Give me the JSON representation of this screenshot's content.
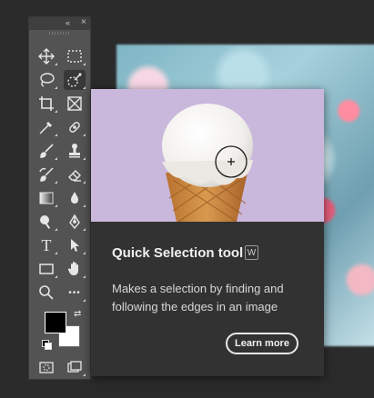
{
  "toolbar": {
    "collapse_glyph": "«",
    "close_glyph": "×",
    "tools": [
      {
        "icon": "move-icon"
      },
      {
        "icon": "rectangular-marquee-icon"
      },
      {
        "icon": "lasso-icon"
      },
      {
        "icon": "quick-selection-icon",
        "active": true
      },
      {
        "icon": "crop-icon"
      },
      {
        "icon": "frame-icon"
      },
      {
        "icon": "eyedropper-icon"
      },
      {
        "icon": "spot-healing-brush-icon"
      },
      {
        "icon": "brush-icon"
      },
      {
        "icon": "clone-stamp-icon"
      },
      {
        "icon": "history-brush-icon"
      },
      {
        "icon": "eraser-icon"
      },
      {
        "icon": "gradient-icon"
      },
      {
        "icon": "blur-icon"
      },
      {
        "icon": "dodge-icon"
      },
      {
        "icon": "pen-icon"
      },
      {
        "icon": "type-icon"
      },
      {
        "icon": "path-selection-icon"
      },
      {
        "icon": "rectangle-icon"
      },
      {
        "icon": "hand-icon"
      },
      {
        "icon": "zoom-icon"
      },
      {
        "icon": "more-tools-icon"
      }
    ],
    "foreground_color": "#000000",
    "background_color": "#ffffff",
    "type_glyph": "T",
    "more_glyph": "•••"
  },
  "tooltip": {
    "title": "Quick Selection tool",
    "shortcut": "W",
    "description": "Makes a selection by finding and following the edges in an image",
    "learn_more": "Learn more",
    "image_bg": "#c9b8dc"
  },
  "colors": {
    "panel_bg": "#535353",
    "app_bg": "#2b2b2b",
    "card_bg": "#323232"
  }
}
